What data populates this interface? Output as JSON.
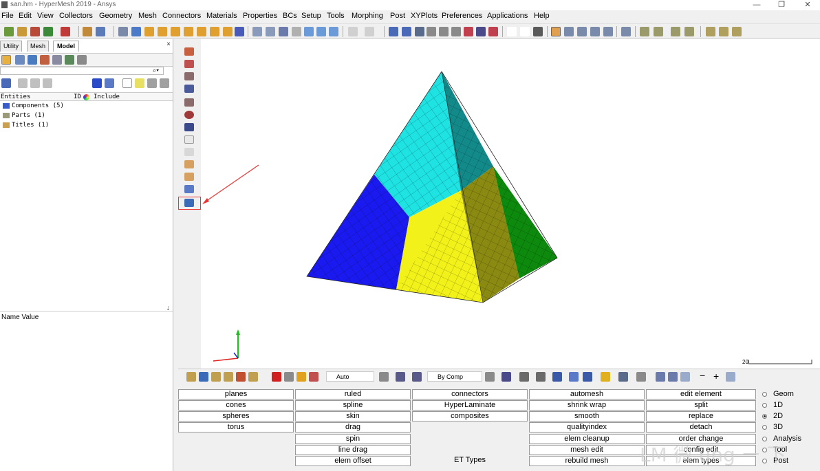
{
  "window": {
    "title": "san.hm - HyperMesh 2019 - Ansys",
    "minimize": "—",
    "restore": "❐",
    "close": "✕"
  },
  "menubar": [
    "File",
    "Edit",
    "View",
    "Collectors",
    "Geometry",
    "Mesh",
    "Connectors",
    "Materials",
    "Properties",
    "BCs",
    "Setup",
    "Tools",
    "Morphing",
    "Post",
    "XYPlots",
    "Preferences",
    "Applications",
    "Help"
  ],
  "left_panel": {
    "tabs": [
      "Utility",
      "Mesh",
      "Model"
    ],
    "active_tab": "Model",
    "close": "×",
    "columns": {
      "entities": "Entities",
      "id": "ID",
      "include": "Include"
    },
    "tree": [
      {
        "label": "Components (5)",
        "icon": "components-icon"
      },
      {
        "label": "Parts (1)",
        "icon": "parts-icon"
      },
      {
        "label": "Titles (1)",
        "icon": "titles-icon"
      }
    ],
    "name_value_header": "Name Value"
  },
  "viewport": {
    "scale_label": "20",
    "colors": {
      "cyan": "#1fe3e3",
      "teal": "#138a8a",
      "blue": "#1a1af0",
      "yellow": "#f2f21a",
      "olive": "#8a8a12",
      "green": "#0d8a0d",
      "arrow": "#ee3333"
    }
  },
  "bottom_toolbar": {
    "auto_select": "Auto",
    "color_by": "By Comp"
  },
  "mesh_menu": {
    "columns": [
      [
        "planes",
        "cones",
        "spheres",
        "torus",
        "",
        "",
        ""
      ],
      [
        "ruled",
        "spline",
        "skin",
        "drag",
        "spin",
        "line drag",
        "elem offset"
      ],
      [
        "connectors",
        "HyperLaminate",
        "composites",
        "",
        "",
        "",
        "ET Types"
      ],
      [
        "automesh",
        "shrink wrap",
        "smooth",
        "qualityindex",
        "elem cleanup",
        "mesh edit",
        "rebuild mesh"
      ],
      [
        "edit element",
        "split",
        "replace",
        "detach",
        "order change",
        "config edit",
        "elem types"
      ]
    ]
  },
  "page_selector": {
    "options": [
      "Geom",
      "1D",
      "2D",
      "3D",
      "Analysis",
      "Tool",
      "Post"
    ],
    "selected": "2D"
  },
  "watermark": "LM 微 ung ー 下"
}
